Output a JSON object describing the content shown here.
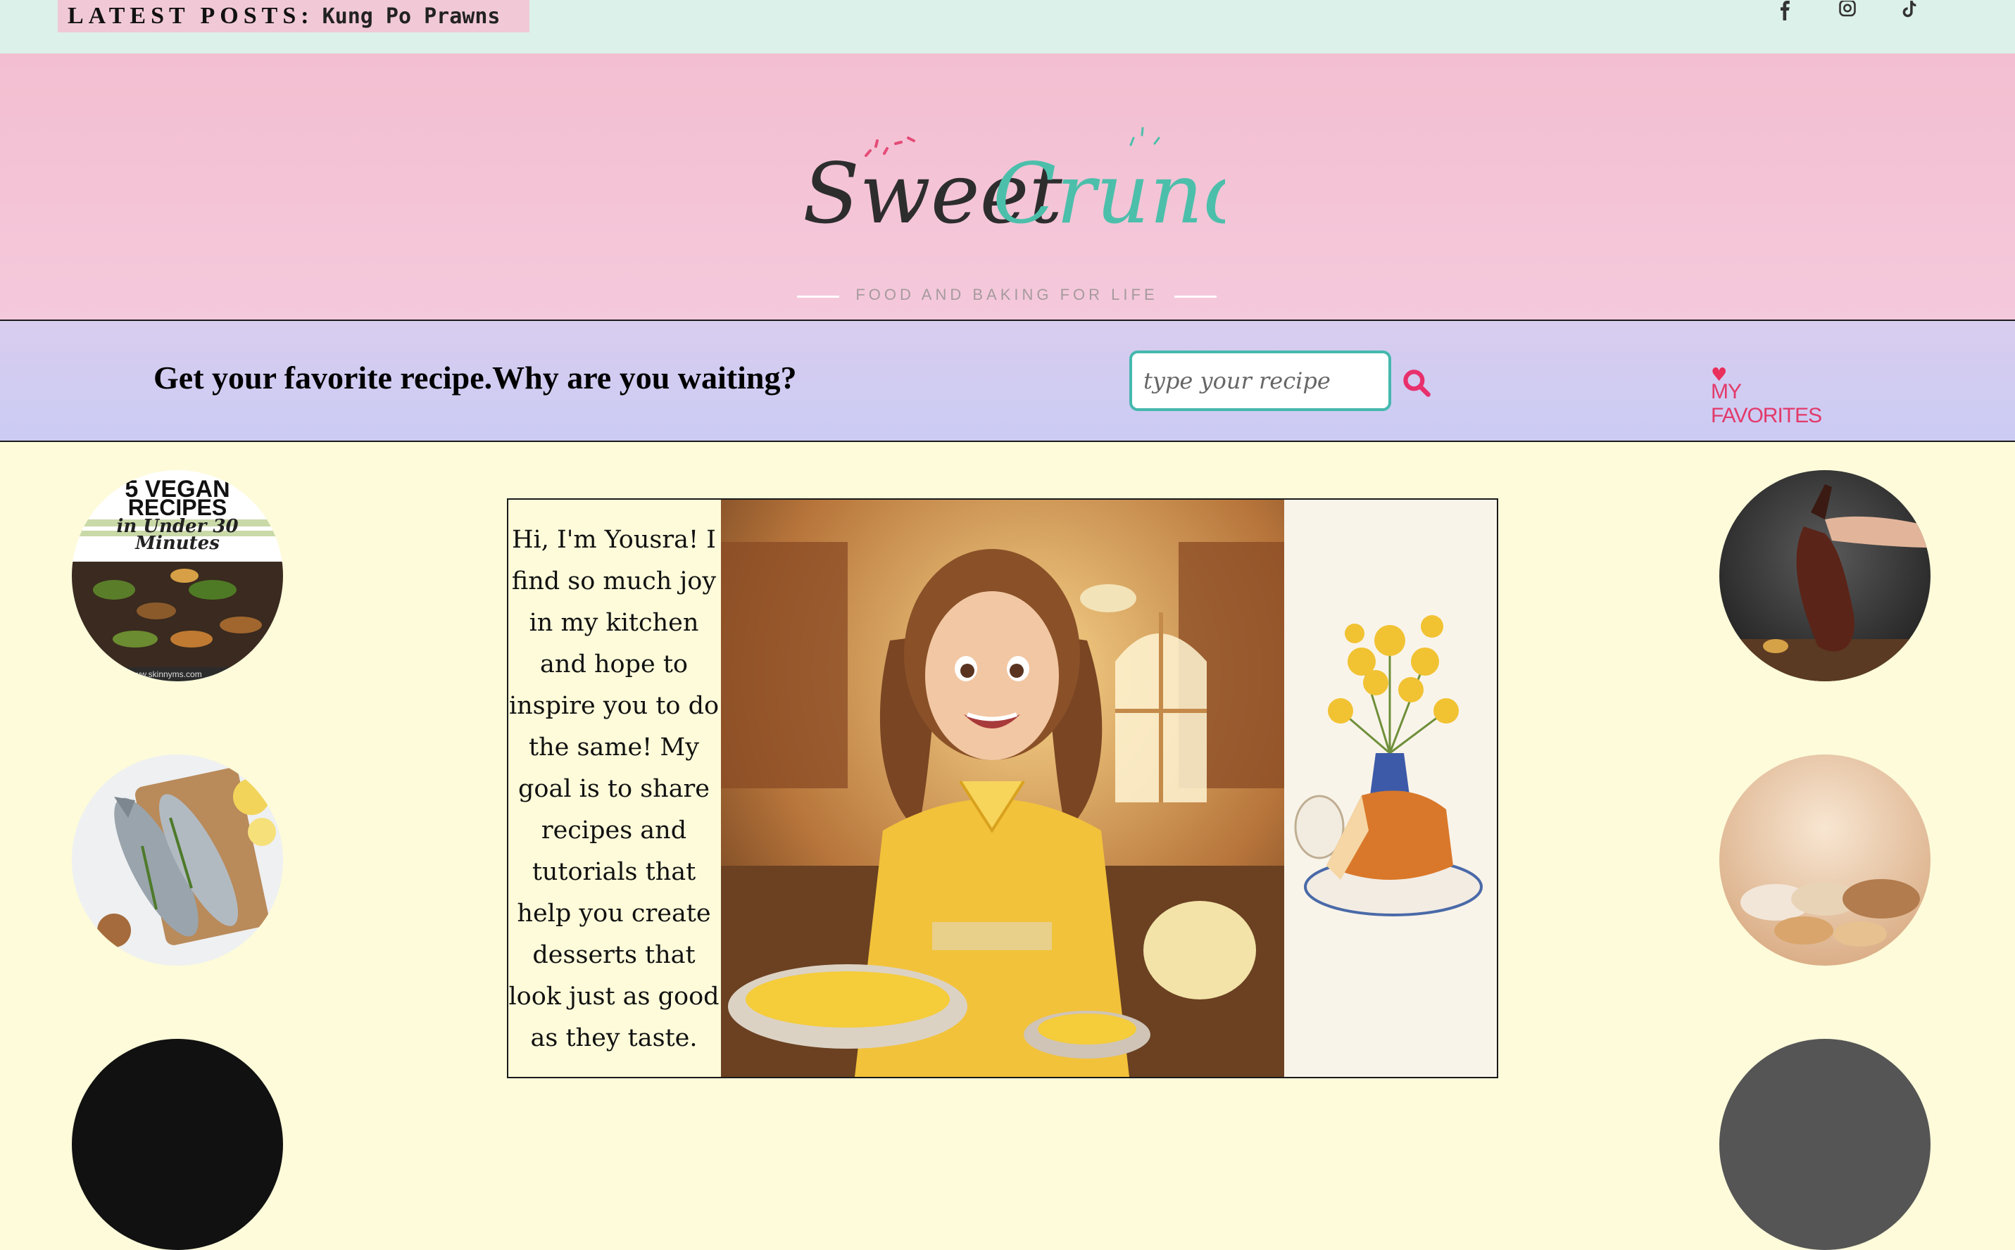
{
  "top_bar": {
    "latest_label": "LATEST POSTS:",
    "latest_post": "Kung Po Prawns",
    "social_icons": [
      "facebook-icon",
      "instagram-icon",
      "tiktok-icon"
    ]
  },
  "header": {
    "logo_word_1": "Sweet",
    "logo_word_2": "Crunch",
    "logo_tagline": "FOOD AND BAKING FOR LIFE"
  },
  "search_bar": {
    "tagline": "Get your favorite recipe.Why are you waiting?",
    "search_placeholder": "type your recipe",
    "favorites_label": "MY FAVORITES"
  },
  "left_circles": {
    "vegan": {
      "line1": "5 VEGAN",
      "line2": "RECIPES",
      "line3": "in Under 30",
      "line4": "Minutes",
      "site": "www.skinnyms.com"
    }
  },
  "intro": {
    "text": "Hi, I'm Yousra! I find so much joy in my kitchen and hope to inspire you to do the same! My goal is to share recipes and tutorials that help you create desserts that look just as good as they taste."
  },
  "colors": {
    "top_bar_bg": "#dcf1e9",
    "header_pink": "#f3bed1",
    "search_bar_lavender": "#cfcdf2",
    "page_cream": "#fdfbda",
    "accent_teal": "#4cbfab",
    "accent_pink": "#e23a6a"
  }
}
